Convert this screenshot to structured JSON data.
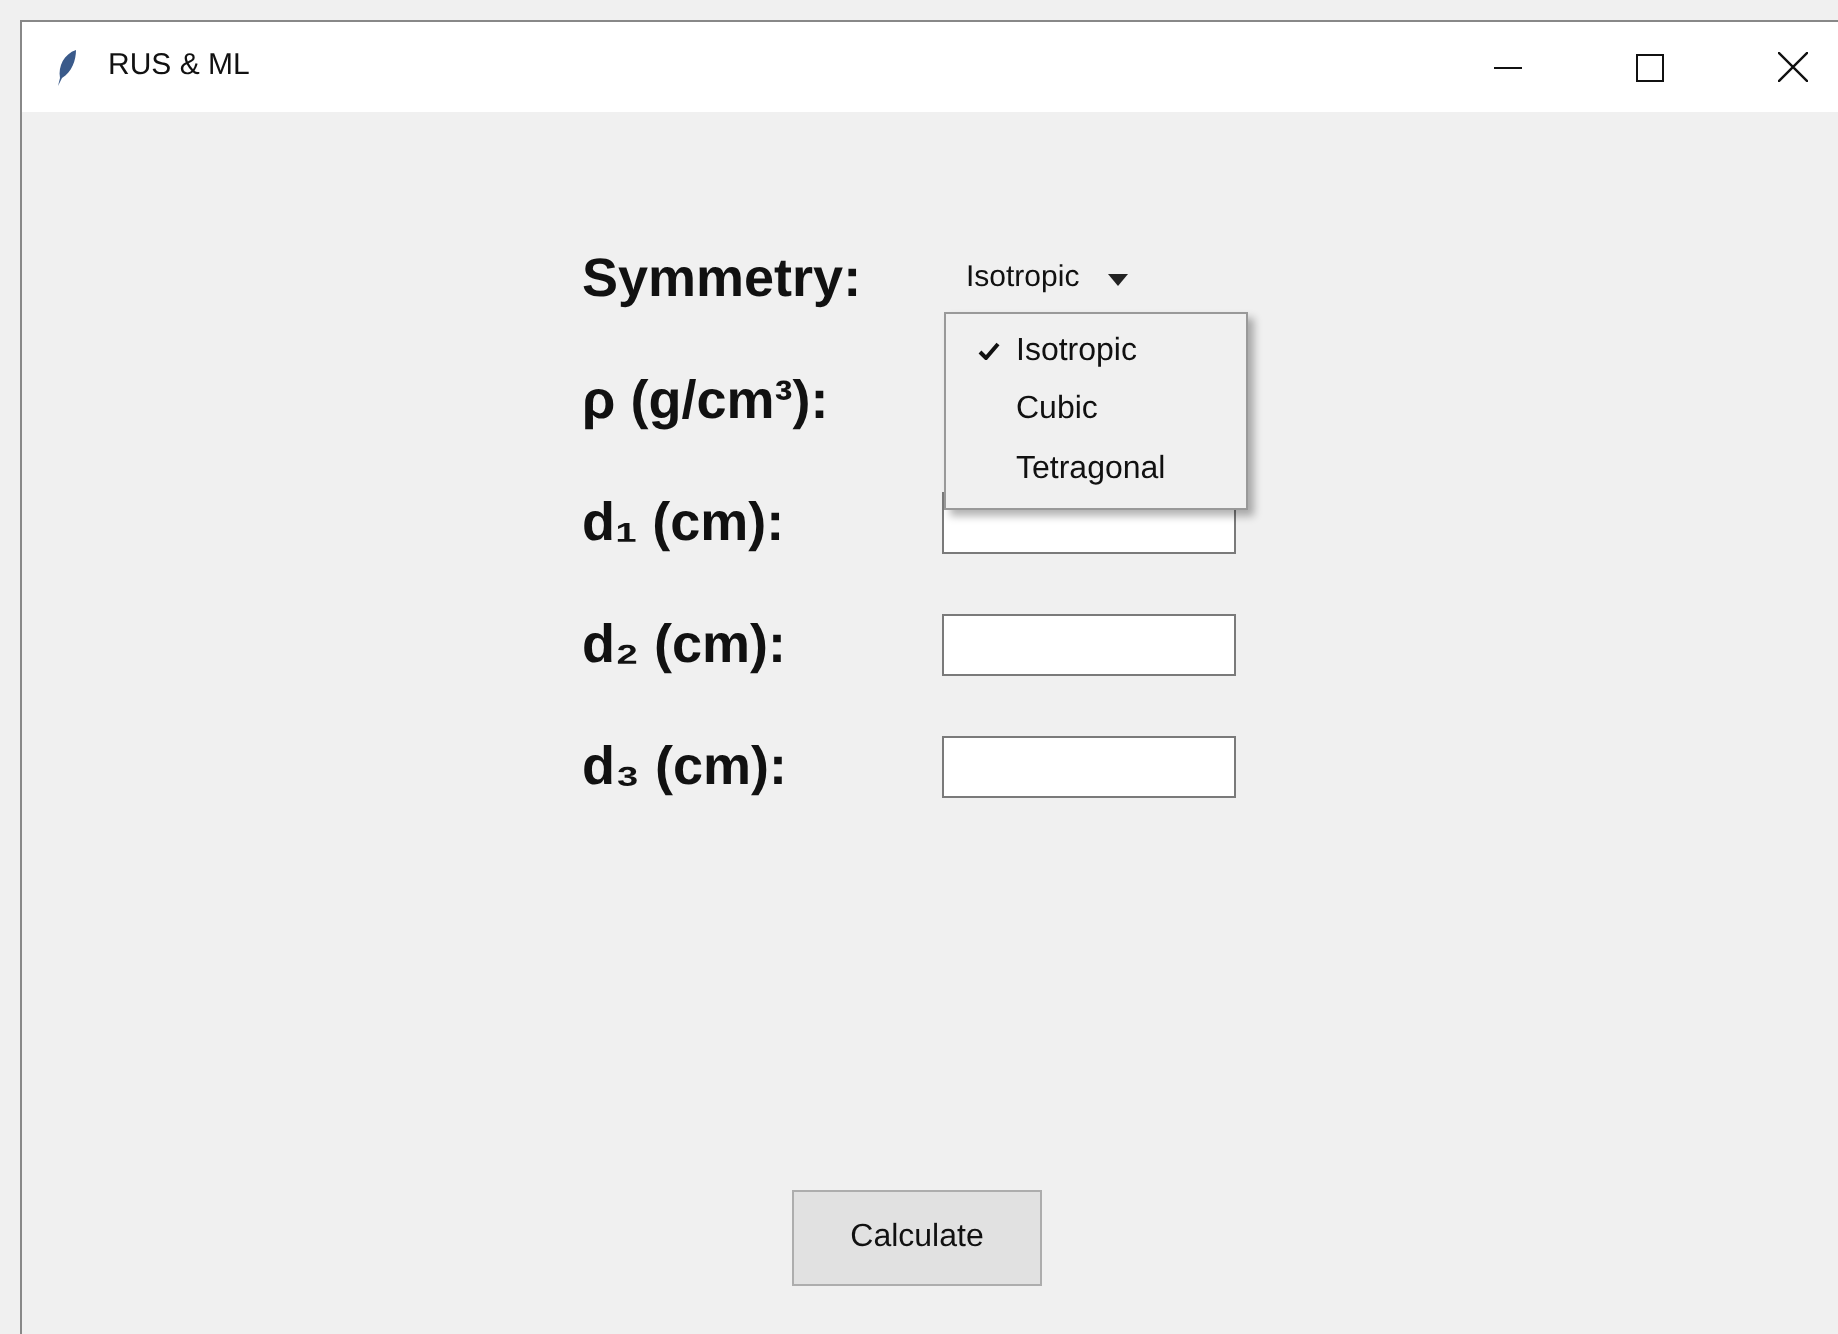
{
  "window": {
    "title": "RUS & ML"
  },
  "symmetry": {
    "label": "Symmetry:",
    "value": "Isotropic",
    "expanded": true,
    "options": [
      {
        "label": "Isotropic",
        "selected": true
      },
      {
        "label": "Cubic",
        "selected": false
      },
      {
        "label": "Tetragonal",
        "selected": false
      }
    ]
  },
  "fields": [
    {
      "label": "ρ (g/cm³):",
      "input_visible": false
    },
    {
      "label": "d₁ (cm):",
      "input_visible": true
    },
    {
      "label": "d₂ (cm):",
      "input_visible": true
    },
    {
      "label": "d₃ (cm):",
      "input_visible": true
    }
  ],
  "button": "Calculate"
}
